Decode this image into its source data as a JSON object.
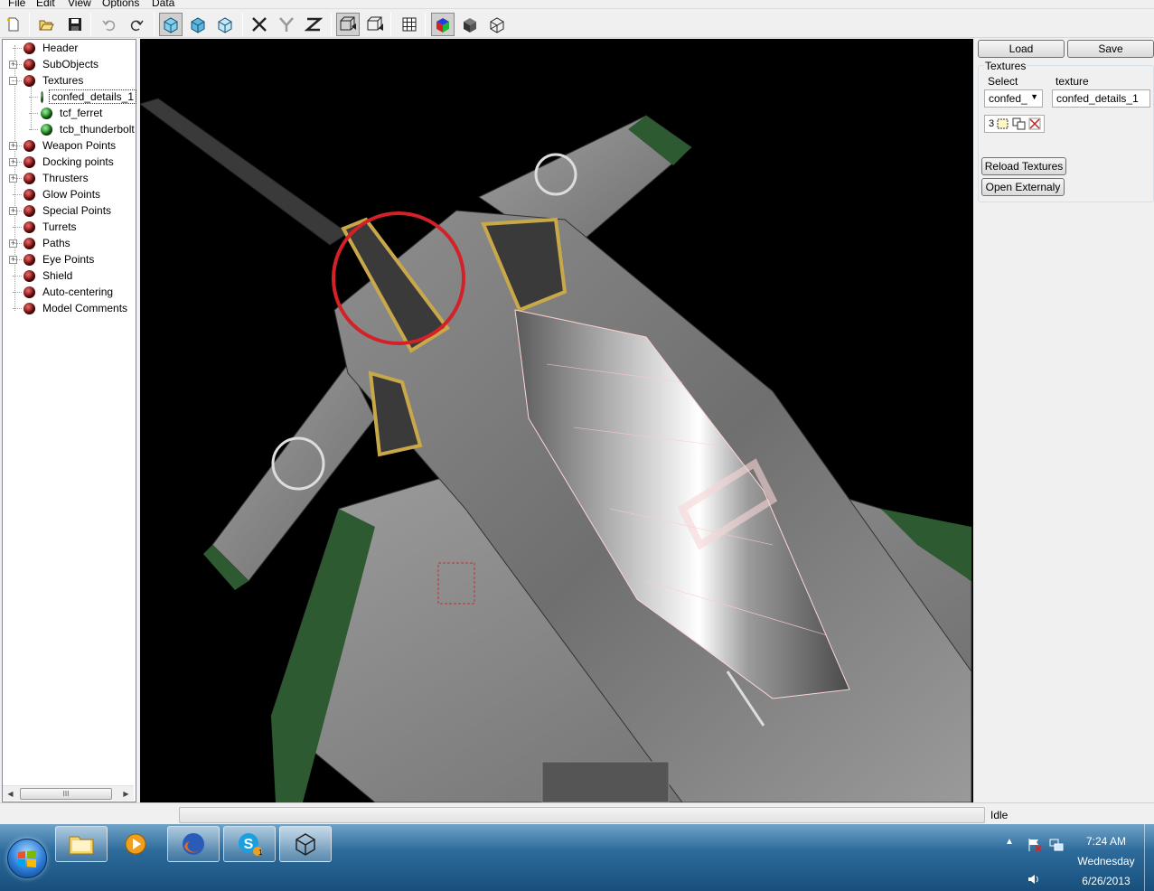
{
  "menu": [
    "File",
    "Edit",
    "View",
    "Options",
    "Data"
  ],
  "tree": {
    "items": [
      {
        "label": "Header",
        "kind": "red"
      },
      {
        "label": "SubObjects",
        "kind": "red"
      },
      {
        "label": "Textures",
        "kind": "red"
      },
      {
        "label": "confed_details_1",
        "kind": "green"
      },
      {
        "label": "tcf_ferret",
        "kind": "green"
      },
      {
        "label": "tcb_thunderbolt",
        "kind": "green"
      },
      {
        "label": "Weapon Points",
        "kind": "red"
      },
      {
        "label": "Docking points",
        "kind": "red"
      },
      {
        "label": "Thrusters",
        "kind": "red"
      },
      {
        "label": "Glow Points",
        "kind": "red"
      },
      {
        "label": "Special Points",
        "kind": "red"
      },
      {
        "label": "Turrets",
        "kind": "red"
      },
      {
        "label": "Paths",
        "kind": "red"
      },
      {
        "label": "Eye Points",
        "kind": "red"
      },
      {
        "label": "Shield",
        "kind": "red"
      },
      {
        "label": "Auto-centering",
        "kind": "red"
      },
      {
        "label": "Model Comments",
        "kind": "red"
      }
    ],
    "scroll_thumb_grip": "III"
  },
  "right_panel": {
    "load_label": "Load",
    "save_label": "Save",
    "group_title": "Textures",
    "select_label": "Select",
    "texture_label": "texture",
    "select_value": "confed_",
    "texture_value": "confed_details_1",
    "icon_strip_number": "3",
    "reload_label": "Reload Textures",
    "open_ext_label": "Open Externaly"
  },
  "status": {
    "text": "Idle"
  },
  "taskbar": {
    "skype_badge": "1",
    "time": "7:24 AM",
    "day": "Wednesday",
    "date": "6/26/2013"
  },
  "colors": {
    "viewport_bg": "#000000",
    "highlight_circle": "#d42027",
    "node_red": "#8a0f0f",
    "node_green": "#1b8a1b"
  }
}
